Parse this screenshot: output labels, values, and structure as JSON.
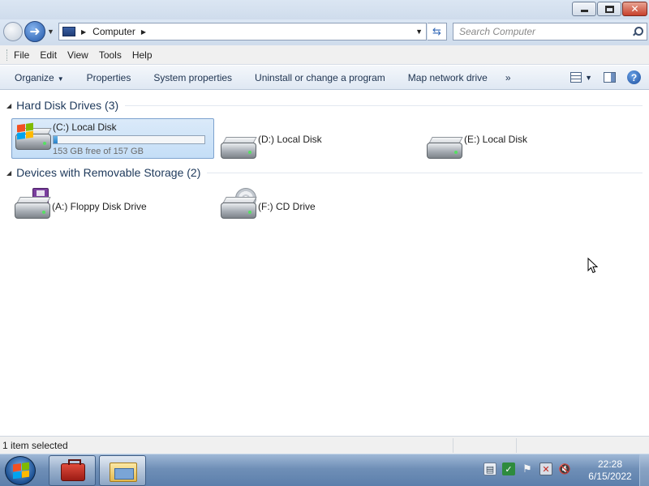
{
  "window": {
    "controls": {
      "minimize": "minimize",
      "maximize": "maximize",
      "close": "✕"
    }
  },
  "address": {
    "path": "Computer",
    "search_placeholder": "Search Computer"
  },
  "menu": [
    "File",
    "Edit",
    "View",
    "Tools",
    "Help"
  ],
  "commands": {
    "organize": "Organize",
    "properties": "Properties",
    "system_properties": "System properties",
    "uninstall": "Uninstall or change a program",
    "map_drive": "Map network drive",
    "more": "»"
  },
  "groups": {
    "hard_disks": {
      "title": "Hard Disk Drives (3)",
      "items": [
        {
          "name": "(C:) Local Disk",
          "free_text": "153 GB free of 157 GB",
          "used_fraction": 0.025,
          "icon": "windows-drive-icon"
        },
        {
          "name": "(D:) Local Disk",
          "icon": "hard-drive-icon"
        },
        {
          "name": "(E:) Local Disk",
          "icon": "hard-drive-icon"
        }
      ]
    },
    "removable": {
      "title": "Devices with Removable Storage (2)",
      "items": [
        {
          "name": "(A:) Floppy Disk Drive",
          "icon": "floppy-drive-icon"
        },
        {
          "name": "(F:) CD Drive",
          "icon": "cd-drive-icon"
        }
      ]
    }
  },
  "status": {
    "text": "1 item selected"
  },
  "taskbar": {
    "clock_time": "22:28",
    "clock_date": "6/15/2022",
    "tray_icons": [
      "notes-icon",
      "security-shield-icon",
      "action-center-flag-icon",
      "network-icon",
      "volume-muted-icon"
    ]
  },
  "colors": {
    "accent": "#1e395b",
    "selection": "#c4def7",
    "drive_bar": "#2881c9"
  }
}
